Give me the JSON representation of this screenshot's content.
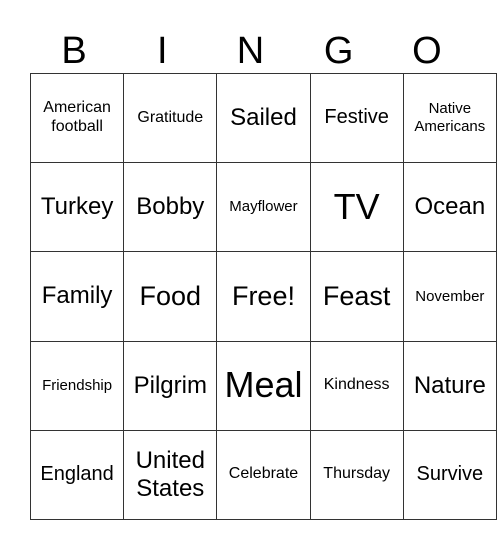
{
  "header": {
    "letters": [
      "B",
      "I",
      "N",
      "G",
      "O"
    ]
  },
  "board": {
    "rows": [
      [
        "American football",
        "Gratitude",
        "Sailed",
        "Festive",
        "Native Americans"
      ],
      [
        "Turkey",
        "Bobby",
        "Mayflower",
        "TV",
        "Ocean"
      ],
      [
        "Family",
        "Food",
        "Free!",
        "Feast",
        "November"
      ],
      [
        "Friendship",
        "Pilgrim",
        "Meal",
        "Kindness",
        "Nature"
      ],
      [
        "England",
        "United States",
        "Celebrate",
        "Thursday",
        "Survive"
      ]
    ],
    "free_space": "Free!"
  }
}
